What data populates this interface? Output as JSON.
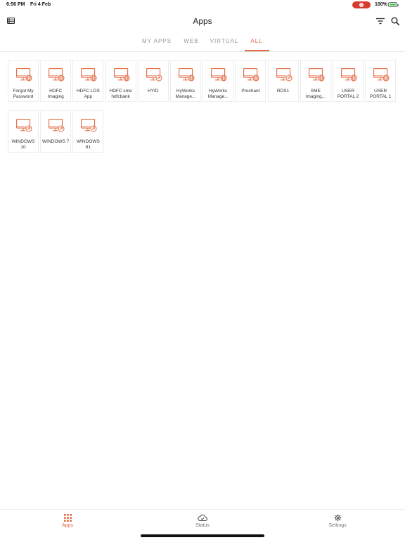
{
  "status_bar": {
    "time": "6:56 PM",
    "date": "Fri 4 Feb",
    "battery": "100%"
  },
  "header": {
    "title": "Apps"
  },
  "tabs": [
    {
      "label": "MY APPS",
      "active": false
    },
    {
      "label": "WEB",
      "active": false
    },
    {
      "label": "VIRTUAL",
      "active": false
    },
    {
      "label": "ALL",
      "active": true
    }
  ],
  "apps": [
    {
      "label": "Forgot My Password",
      "icon": "web-app-icon"
    },
    {
      "label": "HDFC Imaging",
      "icon": "web-app-icon"
    },
    {
      "label": "HDFC LOS App",
      "icon": "web-app-icon"
    },
    {
      "label": "HDFC sme hdfcbank",
      "icon": "web-app-icon"
    },
    {
      "label": "HYID",
      "icon": "virtual-app-icon"
    },
    {
      "label": "HyWorks Manage...",
      "icon": "web-app-icon"
    },
    {
      "label": "HyWorks Manage...",
      "icon": "web-app-icon"
    },
    {
      "label": "Prochant",
      "icon": "web-app-icon"
    },
    {
      "label": "RDS1",
      "icon": "virtual-app-icon"
    },
    {
      "label": "SME Imaging...",
      "icon": "web-app-icon"
    },
    {
      "label": "USER PORTAL 2",
      "icon": "web-app-icon"
    },
    {
      "label": "USER PORTAL 1",
      "icon": "web-app-icon"
    },
    {
      "label": "WINDOWS 10",
      "icon": "virtual-app-icon"
    },
    {
      "label": "WINDOWS 7",
      "icon": "virtual-app-icon"
    },
    {
      "label": "WINDOWS 81",
      "icon": "virtual-app-icon"
    }
  ],
  "bottom_tabs": [
    {
      "label": "Apps",
      "icon": "grid-icon",
      "active": true
    },
    {
      "label": "Status",
      "icon": "cloud-check-icon",
      "active": false
    },
    {
      "label": "Settings",
      "icon": "gear-icon",
      "active": false
    }
  ],
  "colors": {
    "accent": "#e16a43",
    "recording": "#d63b30"
  }
}
